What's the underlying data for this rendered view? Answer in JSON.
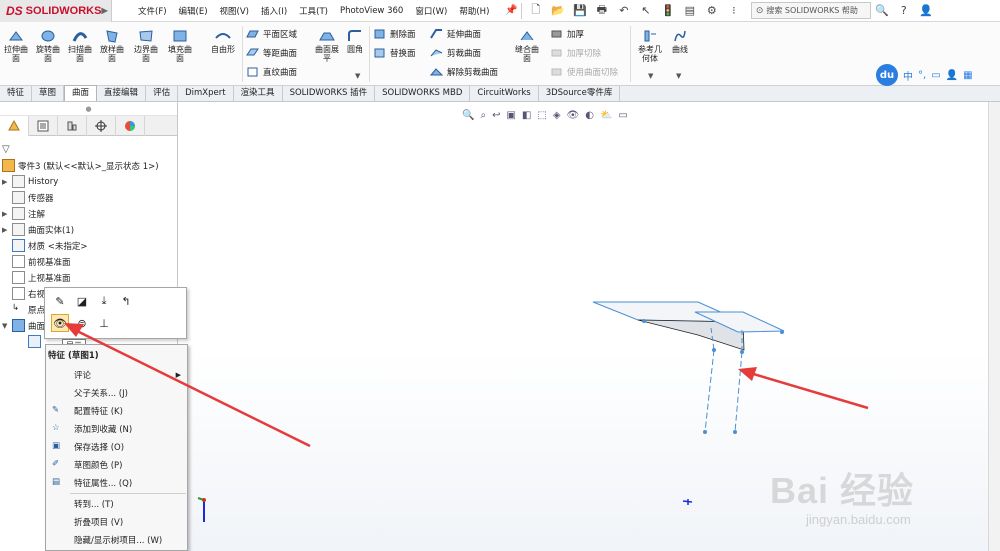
{
  "app": {
    "logo_text": "SOLIDWORKS",
    "logo_mark": "DS",
    "menu": [
      "文件(F)",
      "编辑(E)",
      "视图(V)",
      "插入(I)",
      "工具(T)",
      "PhotoView 360",
      "窗口(W)",
      "帮助(H)"
    ],
    "search_placeholder": "搜索 SOLIDWORKS 帮助",
    "help_symbol": "?"
  },
  "ribbon": {
    "big_buttons": [
      {
        "label": "拉伸曲\n面",
        "icon": "extruded-surface-icon"
      },
      {
        "label": "旋转曲\n面",
        "icon": "revolved-surface-icon"
      },
      {
        "label": "扫描曲\n面",
        "icon": "swept-surface-icon"
      },
      {
        "label": "放样曲\n面",
        "icon": "lofted-surface-icon"
      },
      {
        "label": "边界曲\n面",
        "icon": "boundary-surface-icon"
      },
      {
        "label": "填充曲\n面",
        "icon": "filled-surface-icon"
      },
      {
        "label": "自由形",
        "icon": "freeform-icon"
      }
    ],
    "group2": [
      "平面区域",
      "等距曲面",
      "直纹曲面"
    ],
    "flatten": "曲面展\n平",
    "fillet": "圆角",
    "group3": [
      "删除面",
      "替换面"
    ],
    "group4": [
      "延伸曲面",
      "剪裁曲面",
      "解除剪裁曲面"
    ],
    "knit": "缝合曲\n面",
    "group5": [
      "加厚",
      "加厚切除",
      "使用曲面切除"
    ],
    "ref_geometry": "参考几\n何体",
    "curves": "曲线"
  },
  "tabs": [
    "特征",
    "草图",
    "曲面",
    "直接编辑",
    "评估",
    "DimXpert",
    "渲染工具",
    "SOLIDWORKS 插件",
    "SOLIDWORKS MBD",
    "CircuitWorks",
    "3DSource零件库"
  ],
  "active_tab": "曲面",
  "baidu": {
    "du": "du",
    "cn": "中"
  },
  "tree": {
    "root": "零件3 (默认<<默认>_显示状态 1>)",
    "items": [
      "History",
      "传感器",
      "注解",
      "曲面实体(1)",
      "材质 <未指定>",
      "前视基准面",
      "上视基准面",
      "右视",
      "原点",
      "曲面"
    ]
  },
  "tooltip": "显示",
  "context_menu": {
    "header": "特征 (草图1)",
    "items": [
      {
        "label": "评论",
        "submenu": true
      },
      {
        "label": "父子关系... (J)"
      },
      {
        "label": "配置特征 (K)"
      },
      {
        "label": "添加到收藏 (N)"
      },
      {
        "label": "保存选择 (O)"
      },
      {
        "label": "草图颜色 (P)"
      },
      {
        "label": "特征属性... (Q)"
      },
      {
        "label": "转到... (T)"
      },
      {
        "label": "折叠项目 (V)"
      },
      {
        "label": "隐藏/显示树项目... (W)"
      }
    ]
  },
  "watermark": {
    "main": "Bai 经验",
    "sub": "jingyan.baidu.com"
  },
  "colors": {
    "accent": "#e53b3b",
    "brand_red": "#c8102e",
    "sketch_blue": "#3d8fd8"
  }
}
